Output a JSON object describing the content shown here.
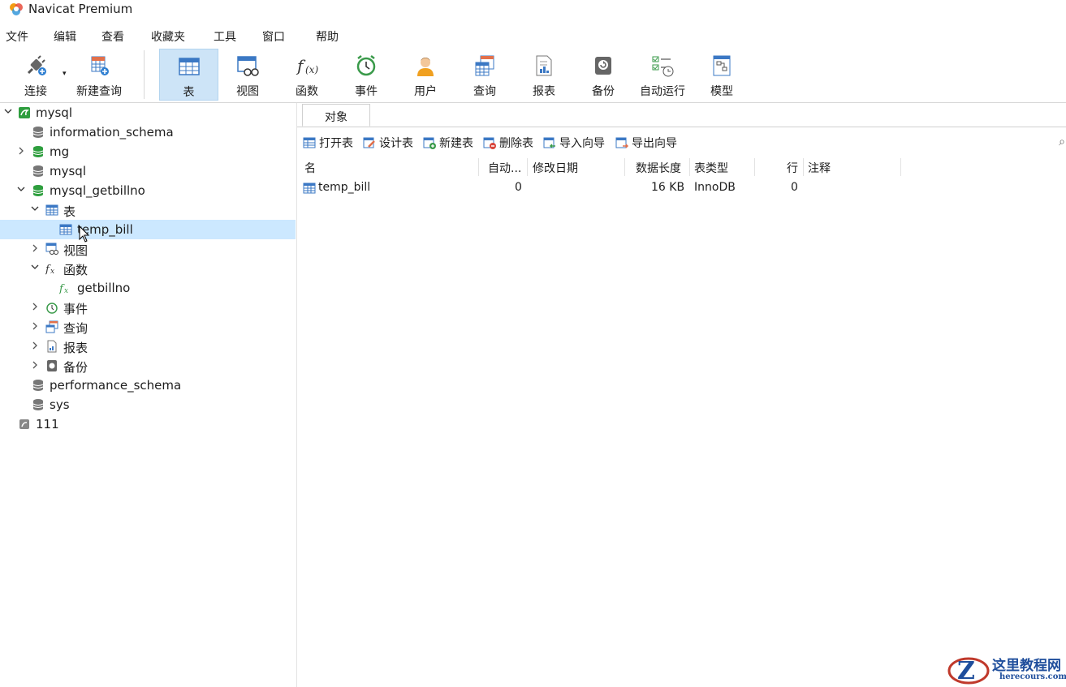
{
  "window": {
    "title": "Navicat Premium"
  },
  "menu": [
    "文件",
    "编辑",
    "查看",
    "收藏夹",
    "工具",
    "窗口",
    "帮助"
  ],
  "toolbar": {
    "connect": "连接",
    "new_query": "新建查询",
    "table": "表",
    "view": "视图",
    "function": "函数",
    "event": "事件",
    "user": "用户",
    "query": "查询",
    "report": "报表",
    "backup": "备份",
    "schedule": "自动运行",
    "model": "模型"
  },
  "tree": {
    "conn_mysql": "mysql",
    "db_information_schema": "information_schema",
    "db_mg": "mg",
    "db_mysql": "mysql",
    "db_getbillno": "mysql_getbillno",
    "grp_tables": "表",
    "tbl_temp_bill": "temp_bill",
    "grp_views": "视图",
    "grp_functions": "函数",
    "fn_getbillno": "getbillno",
    "grp_events": "事件",
    "grp_queries": "查询",
    "grp_reports": "报表",
    "grp_backups": "备份",
    "db_performance_schema": "performance_schema",
    "db_sys": "sys",
    "conn_111": "111"
  },
  "tabs": {
    "objects": "对象"
  },
  "objbar": {
    "open": "打开表",
    "design": "设计表",
    "new": "新建表",
    "delete": "删除表",
    "import": "导入向导",
    "export": "导出向导"
  },
  "grid": {
    "headers": {
      "name": "名",
      "auto_inc": "自动...",
      "modified": "修改日期",
      "data_length": "数据长度",
      "engine": "表类型",
      "rows": "行",
      "comment": "注释"
    },
    "rows": [
      {
        "name": "temp_bill",
        "auto_inc": "0",
        "modified": "",
        "data_length": "16 KB",
        "engine": "InnoDB",
        "rows": "0",
        "comment": ""
      }
    ]
  },
  "watermark": {
    "title": "这里教程网",
    "url": "herecours.com"
  },
  "colors": {
    "selection": "#cce8ff",
    "toolbar_active": "#cde4f7",
    "db_active": "#2e9e3e",
    "table_blue": "#3b78c4"
  }
}
